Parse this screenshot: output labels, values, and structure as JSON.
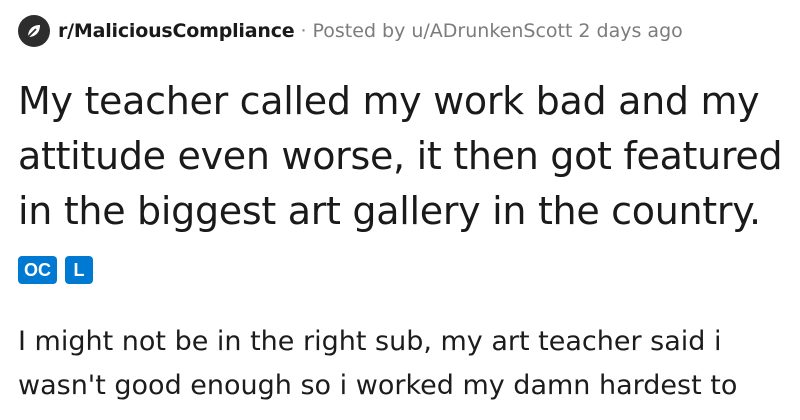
{
  "meta": {
    "subreddit": "r/MaliciousCompliance",
    "separator": "·",
    "posted_by_prefix": "Posted by",
    "username": "u/ADrunkenScott",
    "time": "2 days ago",
    "icon": "subreddit-leaf-icon"
  },
  "post": {
    "title_lines": [
      "My teacher called my work bad and my",
      "attitude even worse, it then got featured",
      "in the biggest art gallery in the country."
    ],
    "flairs": [
      "OC",
      "L"
    ],
    "body_lines": [
      "I might not be in the right sub, my art teacher said i",
      "wasn't good enough so i worked my damn hardest to"
    ]
  },
  "colors": {
    "flair_background": "#0079d3",
    "meta_text": "#7c7c7c",
    "title_text": "#1a1a1b"
  }
}
